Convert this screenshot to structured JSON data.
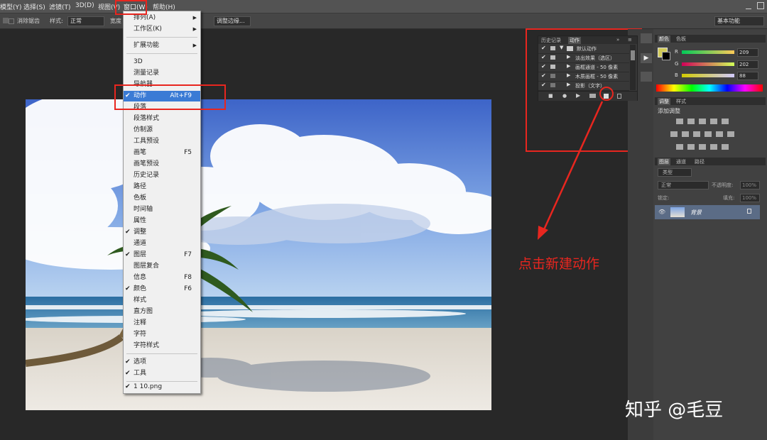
{
  "menubar": {
    "items": [
      "模型(Y)",
      "选择(S)",
      "滤镜(T)",
      "3D(D)",
      "视图(V)",
      "窗口(W)",
      "帮助(H)"
    ]
  },
  "optionsbar": {
    "antialias": "消除锯齿",
    "style_label": "样式:",
    "style_value": "正常",
    "width_label": "宽度",
    "refine": "调整边缘...",
    "workspace": "基本功能"
  },
  "window_menu": {
    "items": [
      {
        "label": "排列(A)",
        "submenu": true
      },
      {
        "label": "工作区(K)",
        "submenu": true
      },
      {
        "label": "扩展功能",
        "submenu": true
      },
      {
        "label": "3D"
      },
      {
        "label": "测量记录"
      },
      {
        "label": "导航器"
      },
      {
        "label": "动作",
        "shortcut": "Alt+F9",
        "checked": true,
        "selected": true
      },
      {
        "label": "段落"
      },
      {
        "label": "段落样式"
      },
      {
        "label": "仿制源"
      },
      {
        "label": "工具预设"
      },
      {
        "label": "画笔",
        "shortcut": "F5"
      },
      {
        "label": "画笔预设"
      },
      {
        "label": "历史记录"
      },
      {
        "label": "路径"
      },
      {
        "label": "色板"
      },
      {
        "label": "时间轴"
      },
      {
        "label": "属性"
      },
      {
        "label": "调整",
        "checked": true
      },
      {
        "label": "通道"
      },
      {
        "label": "图层",
        "shortcut": "F7",
        "checked": true
      },
      {
        "label": "图层复合"
      },
      {
        "label": "信息",
        "shortcut": "F8"
      },
      {
        "label": "颜色",
        "shortcut": "F6",
        "checked": true
      },
      {
        "label": "样式"
      },
      {
        "label": "直方图"
      },
      {
        "label": "注释"
      },
      {
        "label": "字符"
      },
      {
        "label": "字符样式"
      },
      {
        "label": "选项",
        "checked": true
      },
      {
        "label": "工具",
        "checked": true
      },
      {
        "label": "1 10.png",
        "checked": true
      }
    ],
    "check_glyph": "✔",
    "arrow_glyph": "▶"
  },
  "actions_panel": {
    "tabs": [
      "历史记录",
      "动作"
    ],
    "rows": [
      {
        "name": "默认动作",
        "level": 0
      },
      {
        "name": "淡出效果（选区）",
        "level": 1
      },
      {
        "name": "画框通道 - 50 像素",
        "level": 1
      },
      {
        "name": "木质画框 - 50 像素",
        "level": 1
      },
      {
        "name": "投影（文字）",
        "level": 1
      }
    ]
  },
  "color_panel": {
    "tabs": [
      "颜色",
      "色板"
    ],
    "channels": [
      {
        "label": "R",
        "value": "209"
      },
      {
        "label": "G",
        "value": "202"
      },
      {
        "label": "B",
        "value": "88"
      }
    ],
    "foreground_color": "#d1ca58"
  },
  "adjust_panel": {
    "tabs": [
      "调整",
      "样式"
    ],
    "title": "添加调整"
  },
  "layers_panel": {
    "tabs": [
      "图层",
      "通道",
      "路径"
    ],
    "filter": "类型",
    "blend": "正常",
    "opacity_label": "不透明度:",
    "opacity": "100%",
    "lock_label": "锁定:",
    "fill_label": "填充:",
    "fill": "100%",
    "layer_name": "背景"
  },
  "annotation": {
    "text": "点击新建动作",
    "color": "#e8261f"
  },
  "watermark": "知乎 @毛豆"
}
